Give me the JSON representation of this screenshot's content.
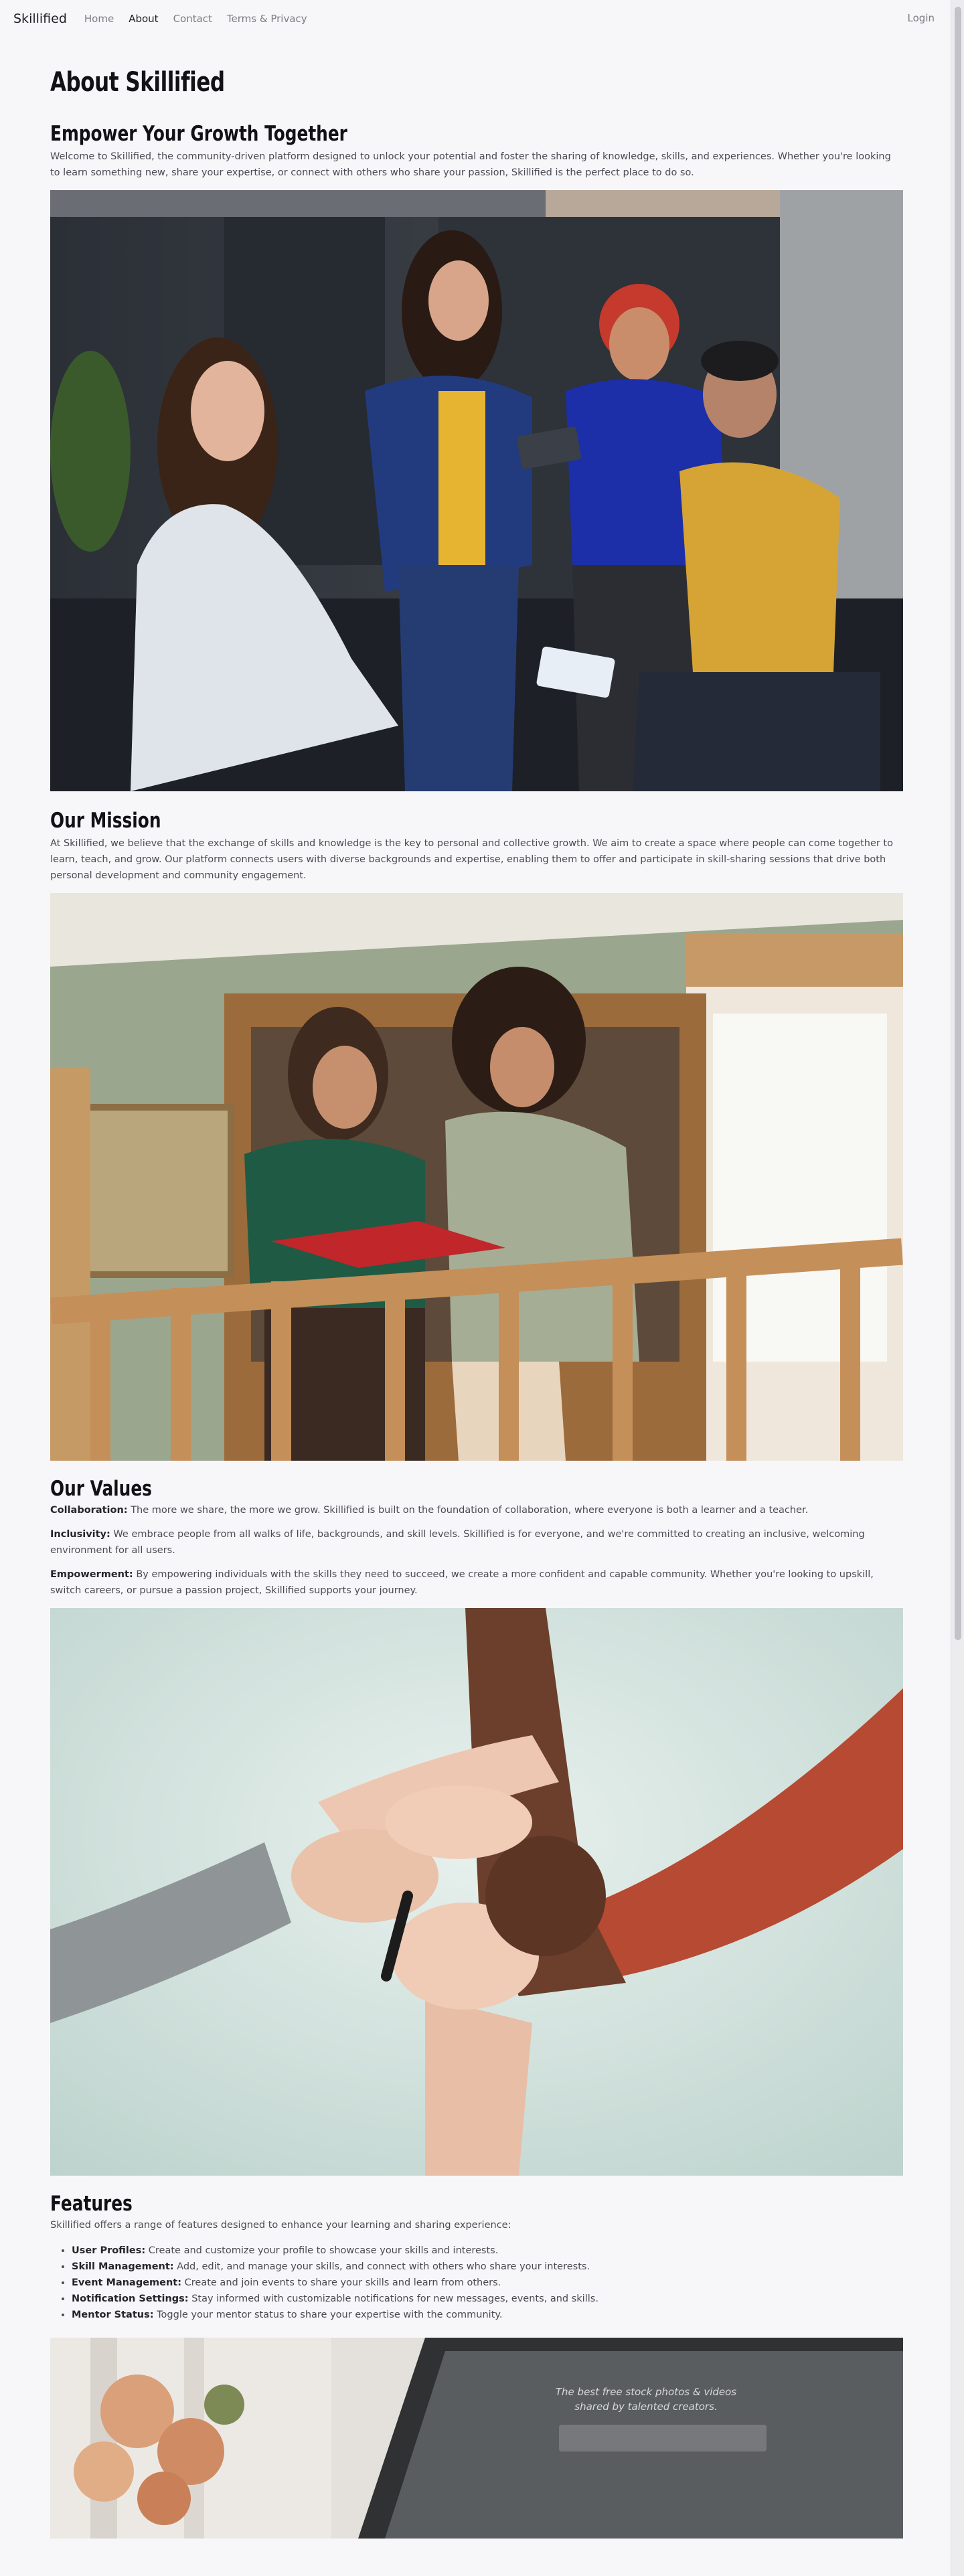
{
  "nav": {
    "brand": "Skillified",
    "links": [
      "Home",
      "About",
      "Contact",
      "Terms & Privacy"
    ],
    "login": "Login"
  },
  "page": {
    "title": "About Skillified",
    "intro_heading": "Empower Your Growth Together",
    "intro_text": "Welcome to Skillified, the community-driven platform designed to unlock your potential and foster the sharing of knowledge, skills, and experiences. Whether you're looking to learn something new, share your expertise, or connect with others who share your passion, Skillified is the perfect place to do so.",
    "mission_heading": "Our Mission",
    "mission_text": "At Skillified, we believe that the exchange of skills and knowledge is the key to personal and collective growth. We aim to create a space where people can come together to learn, teach, and grow. Our platform connects users with diverse backgrounds and expertise, enabling them to offer and participate in skill-sharing sessions that drive both personal development and community engagement.",
    "values_heading": "Our Values",
    "values": [
      {
        "label": "Collaboration:",
        "text": " The more we share, the more we grow. Skillified is built on the foundation of collaboration, where everyone is both a learner and a teacher."
      },
      {
        "label": "Inclusivity:",
        "text": " We embrace people from all walks of life, backgrounds, and skill levels. Skillified is for everyone, and we're committed to creating an inclusive, welcoming environment for all users."
      },
      {
        "label": "Empowerment:",
        "text": " By empowering individuals with the skills they need to succeed, we create a more confident and capable community. Whether you're looking to upskill, switch careers, or pursue a passion project, Skillified supports your journey."
      }
    ],
    "features_heading": "Features",
    "features_intro": "Skillified offers a range of features designed to enhance your learning and sharing experience:",
    "features": [
      {
        "label": "User Profiles:",
        "text": " Create and customize your profile to showcase your skills and interests."
      },
      {
        "label": "Skill Management:",
        "text": " Add, edit, and manage your skills, and connect with others who share your interests."
      },
      {
        "label": "Event Management:",
        "text": " Create and join events to share your skills and learn from others."
      },
      {
        "label": "Notification Settings:",
        "text": " Stay informed with customizable notifications for new messages, events, and skills."
      },
      {
        "label": "Mentor Status:",
        "text": " Toggle your mentor status to share your expertise with the community."
      }
    ],
    "laptop_screen_text": "The best free stock photos & videos shared by talented creators."
  }
}
